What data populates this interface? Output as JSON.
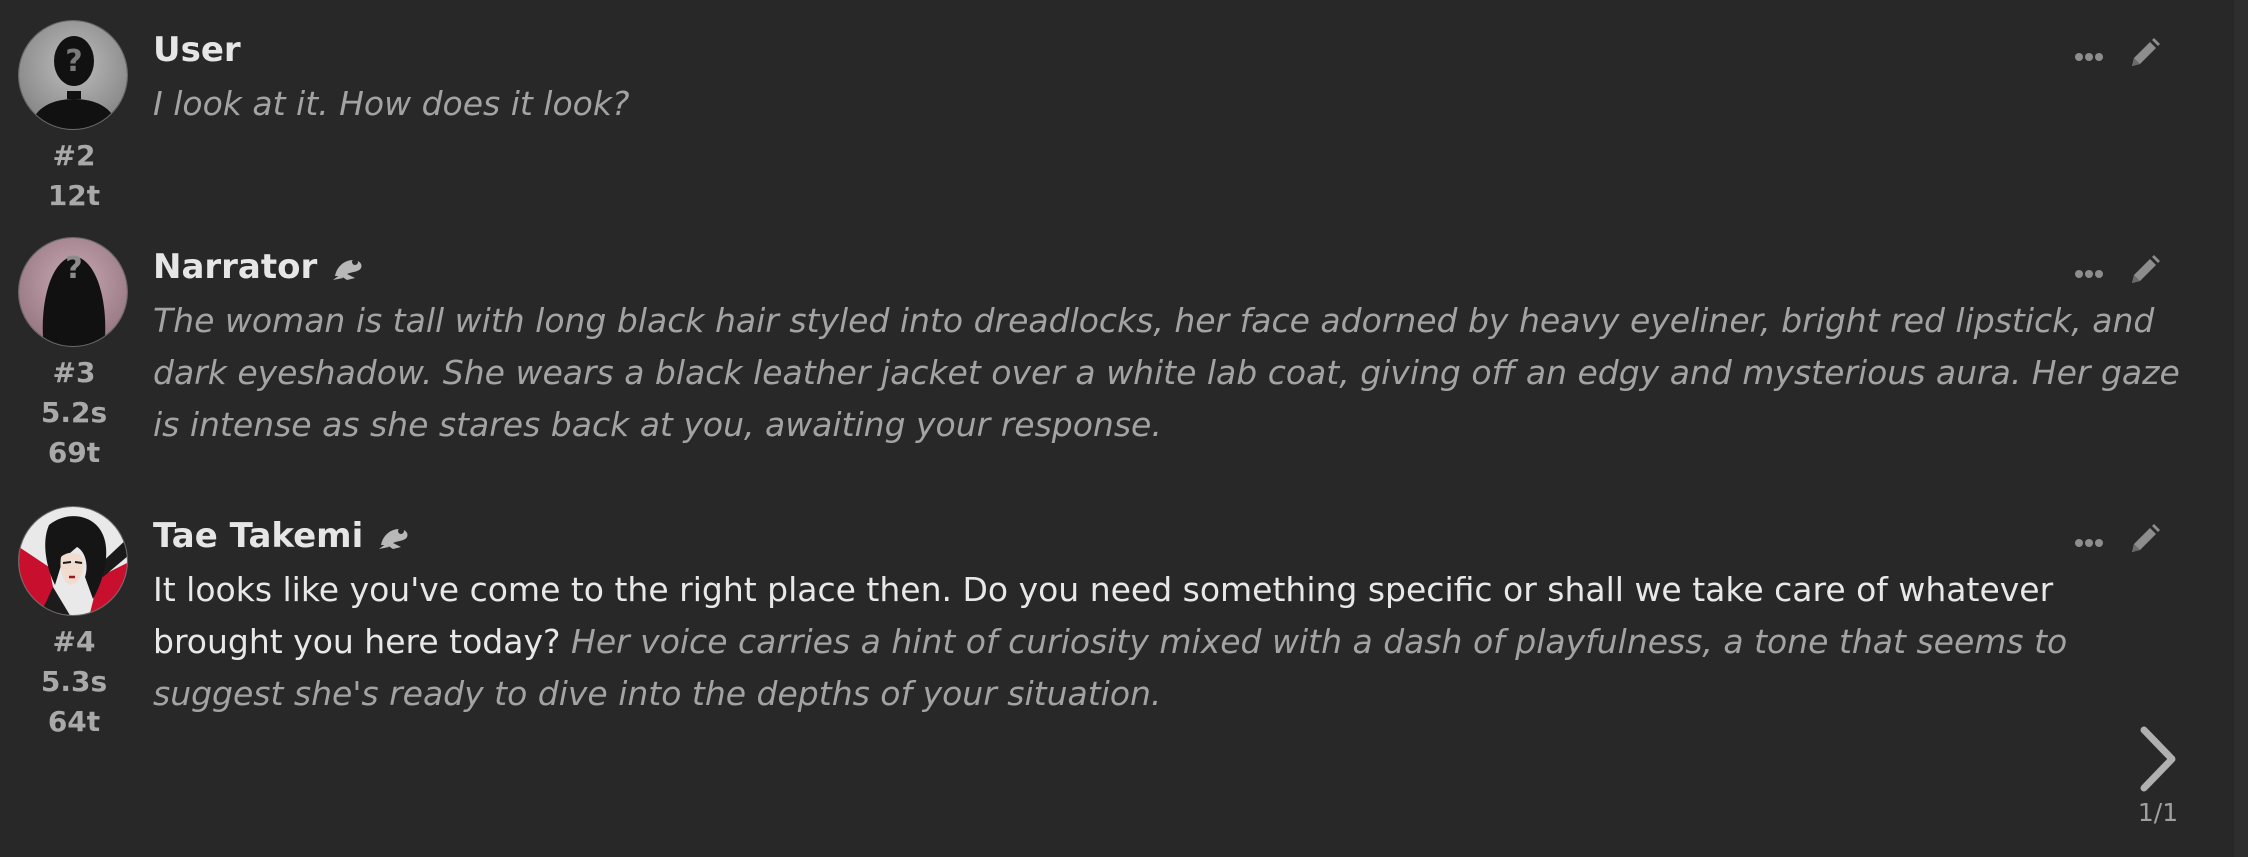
{
  "messages": [
    {
      "name": "User",
      "id": "#2",
      "time": "",
      "tokens": "12t",
      "avatar": "user-placeholder-avatar",
      "parts": [
        {
          "style": "narration",
          "text": "I look at it. How does it look?"
        }
      ]
    },
    {
      "name": "Narrator",
      "id": "#3",
      "time": "5.2s",
      "tokens": "69t",
      "avatar": "narrator-placeholder-avatar",
      "parts": [
        {
          "style": "narration",
          "text": "The woman is tall with long black hair styled into dreadlocks, her face adorned by heavy eyeliner, bright red lipstick, and dark eyeshadow. She wears a black leather jacket over a white lab coat, giving off an edgy and mysterious aura. Her gaze is intense as she stares back at you, awaiting your response."
        }
      ]
    },
    {
      "name": "Tae Takemi",
      "id": "#4",
      "time": "5.3s",
      "tokens": "64t",
      "avatar": "tae-takemi-avatar",
      "parts": [
        {
          "style": "speech",
          "text": "It looks like you've come to the right place then. Do you need something specific or shall we take care of whatever brought you here today? "
        },
        {
          "style": "narration",
          "text": "Her voice carries a hint of curiosity mixed with a dash of playfulness, a tone that seems to suggest she's ready to dive into the depths of your situation."
        }
      ]
    }
  ],
  "swipe": {
    "counter": "1/1",
    "icon": "chevron-right-icon"
  },
  "icons": {
    "more": "ellipsis-icon",
    "edit": "pencil-icon",
    "model": "frog-icon"
  },
  "colors": {
    "background": "#282828",
    "name": "#e6e6e6",
    "narration": "#a3a3a3",
    "speech": "#e8e8e8",
    "meta": "#a9a9a9"
  }
}
